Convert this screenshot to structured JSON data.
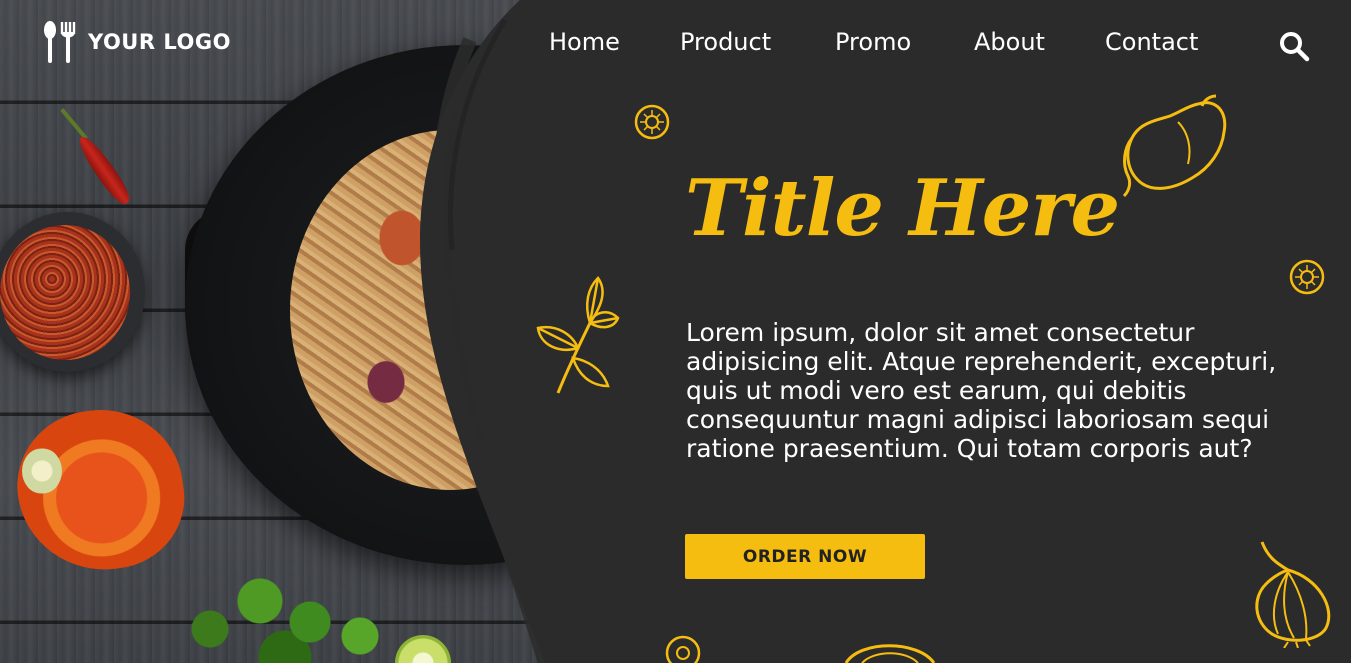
{
  "brand": {
    "logo_text": "YOUR LOGO"
  },
  "nav": {
    "items": [
      {
        "label": "Home"
      },
      {
        "label": "Product"
      },
      {
        "label": "Promo"
      },
      {
        "label": "About"
      },
      {
        "label": "Contact"
      }
    ],
    "search_icon": "search-icon"
  },
  "hero": {
    "title": "Title Here",
    "description": "Lorem ipsum, dolor sit amet consectetur adipisicing elit. Atque reprehenderit, excepturi, quis ut modi vero est earum, qui debitis consequuntur magni adipisci laboriosam sequi ratione praesentium. Qui totam corporis aut?",
    "cta_label": "ORDER NOW"
  },
  "colors": {
    "accent": "#f6bd11",
    "panel": "#2b2b2b",
    "text": "#ffffff"
  },
  "decorations": [
    "lemon-slice-icon",
    "bell-pepper-icon",
    "parsley-icon",
    "onion-icon"
  ]
}
